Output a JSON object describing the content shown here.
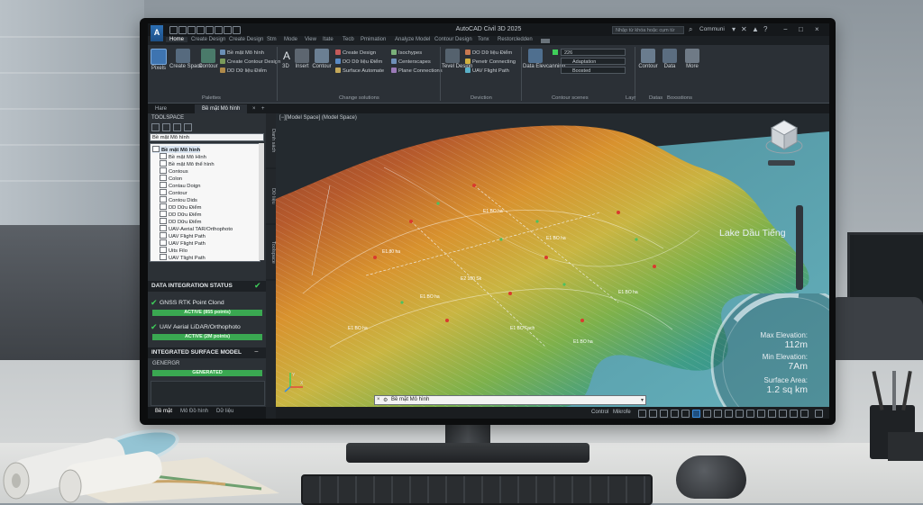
{
  "app": {
    "title": "AutoCAD Civil 3D 2025",
    "logo_text": "A",
    "search_placeholder": "Nhập từ khóa hoặc cụm từ",
    "user": "Communi",
    "help_glyph": "?",
    "window_controls": [
      "−",
      "□",
      "×"
    ]
  },
  "ribbon": {
    "tabs": [
      "Home",
      "Create Design",
      "Create Design",
      "Stm",
      "Mode",
      "View",
      "Itate",
      "Tecb",
      "Pmimation",
      "Analyze Model",
      "Contour Design",
      "Tonx",
      "Restorcledden"
    ],
    "active_tab": 0,
    "buttons": {
      "pixels": "Pixels",
      "create_space": "Create Space",
      "contour": "Contour",
      "dm_mo_hinh": "Bề mặt Mô hình",
      "create_contour_design": "Create Contour Design",
      "dd_lieu_diem": "DD Dữ liệu Điểm",
      "three_d": "3D",
      "insert": "Insert",
      "contour2": "Contour",
      "create_design": "Create Design",
      "dd_lieu_diem2": "DO Dữ liệu Điểm",
      "surface_automate": "Surface Automate",
      "isochypes": "Isochypes",
      "centerscapes": "Centerscapes",
      "plane_connections": "Plane Connections",
      "tevel_design": "Tevel Design",
      "do_lieu_diem3": "DO Dữ liệu Điểm",
      "penetr_connecting": "Penetr Connecting",
      "uav_flight_path": "UAV Flight Path",
      "data_elevcanning": "Data Elevcanning",
      "contour_right": "Contour",
      "data_right": "Data",
      "more": "More"
    },
    "combos": {
      "layer": "226",
      "adaptation": "Adaptation",
      "boosted": "Boosted"
    },
    "panel_labels": [
      "Palettes",
      "Change solutions",
      "Deviction",
      "Contour scenes",
      "Layr",
      "Datas",
      "Boxsstions"
    ]
  },
  "doc_tabs": [
    "Hare",
    "Bề mặt Mô hình"
  ],
  "toolspace": {
    "title": "TOOLSPACE",
    "select_value": "Bề mặt Mô hình",
    "tree": [
      {
        "label": "Bề mặt Mô hình",
        "level": 0,
        "bold": true
      },
      {
        "label": "Bề mặt Mô Hình",
        "level": 1
      },
      {
        "label": "Bề mặt Mô thể hình",
        "level": 1
      },
      {
        "label": "Contous",
        "level": 1
      },
      {
        "label": "Colon",
        "level": 1
      },
      {
        "label": "Contau Doign",
        "level": 1
      },
      {
        "label": "Contour",
        "level": 1
      },
      {
        "label": "Contou Dids",
        "level": 1
      },
      {
        "label": "DD Dữu Điểm",
        "level": 1
      },
      {
        "label": "DD Dữu Điểm",
        "level": 1
      },
      {
        "label": "DD Dữu Điểm",
        "level": 1
      },
      {
        "label": "UAV-Aerial TAR/Orthophoto",
        "level": 1
      },
      {
        "label": "UAV Flight Path",
        "level": 1
      },
      {
        "label": "UAV Flight Path",
        "level": 1
      },
      {
        "label": "Uits Filo",
        "level": 1
      },
      {
        "label": "UAV Tlight Path",
        "level": 1
      }
    ],
    "side_tabs": [
      "Danh sách",
      "Dữ liệu",
      "Toolspace"
    ],
    "data_status": {
      "header": "DATA INTEGRATION STATUS",
      "items": [
        {
          "label": "GNSS RTK Point Clond",
          "status": "ACTIVE (855 points)"
        },
        {
          "label": "UAV Aerial LiDAR/Orthophoto",
          "status": "ACTIVE (2M points)"
        }
      ]
    },
    "surface_model": {
      "header": "INTEGRATED SURFACE MODEL",
      "name": "GENERGR",
      "status": "GENERATED"
    }
  },
  "viewport": {
    "label": "[−][Model Space] (Model Space)",
    "lake_label": "Lake Dầu Tiếng",
    "stats": [
      {
        "label": "Max Elevation:",
        "value": "112m"
      },
      {
        "label": "Min Elevation:",
        "value": "7Am"
      },
      {
        "label": "Surface Area:",
        "value": "1.2 sq km"
      }
    ],
    "command_prompt": "Bề mặt Mô hình",
    "contour_labels": [
      "E1.80 ha",
      "E2 100 Sk",
      "E1 BO ha",
      "E1 BO Fach",
      "E1 BO ha",
      "E1 BO ha",
      "E1 BO ha",
      "E1 BO ha",
      "E1 BO ha"
    ]
  },
  "bottom_tabs": [
    "Bề mặt",
    "Mô Đồ hình",
    "Dữ liệu"
  ],
  "statusbar": {
    "items": [
      "Control",
      "Mikrofe"
    ]
  },
  "colors": {
    "accent": "#3b8ee0",
    "status_green": "#3aa851",
    "lake": "#5aa3b0"
  }
}
